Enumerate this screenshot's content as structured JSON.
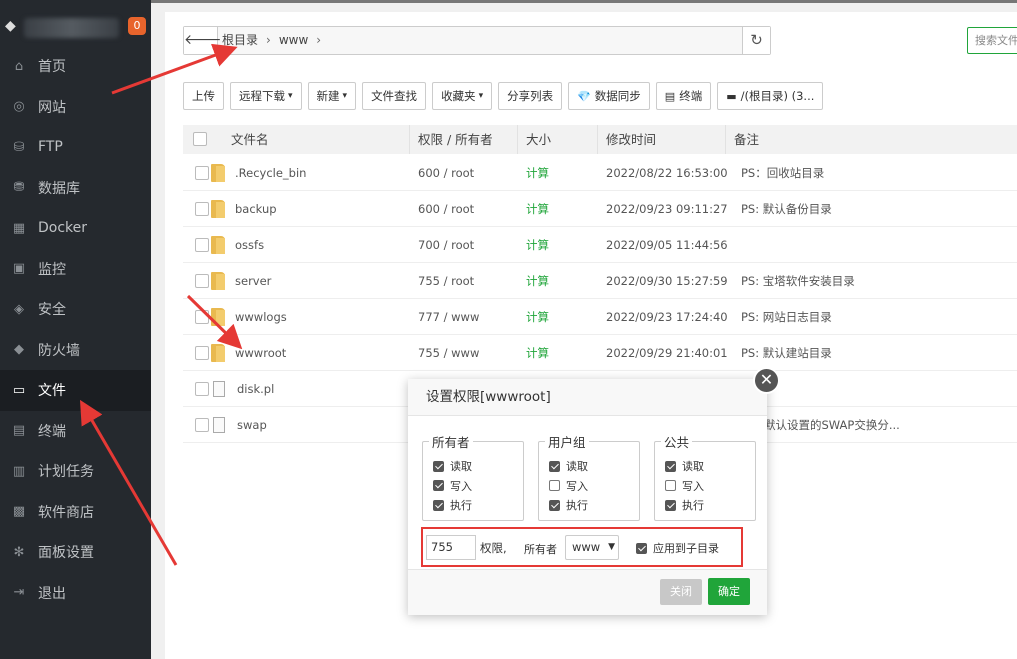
{
  "sidebar": {
    "badge": "0",
    "items": [
      {
        "label": "首页",
        "icon": "home-icon",
        "glyph": "⌂"
      },
      {
        "label": "网站",
        "icon": "globe-icon",
        "glyph": "◎"
      },
      {
        "label": "FTP",
        "icon": "ftp-icon",
        "glyph": "⛁"
      },
      {
        "label": "数据库",
        "icon": "database-icon",
        "glyph": "⛃"
      },
      {
        "label": "Docker",
        "icon": "docker-icon",
        "glyph": "▦"
      },
      {
        "label": "监控",
        "icon": "monitor-icon",
        "glyph": "▣"
      },
      {
        "label": "安全",
        "icon": "shield-check-icon",
        "glyph": "◈"
      },
      {
        "label": "防火墙",
        "icon": "firewall-icon",
        "glyph": "◆"
      },
      {
        "label": "文件",
        "icon": "folder-icon",
        "glyph": "▭"
      },
      {
        "label": "终端",
        "icon": "terminal-icon",
        "glyph": "▤"
      },
      {
        "label": "计划任务",
        "icon": "calendar-icon",
        "glyph": "▥"
      },
      {
        "label": "软件商店",
        "icon": "apps-icon",
        "glyph": "▩"
      },
      {
        "label": "面板设置",
        "icon": "gear-icon",
        "glyph": "✻"
      },
      {
        "label": "退出",
        "icon": "logout-icon",
        "glyph": "⇥"
      }
    ],
    "active_index": 8
  },
  "path": {
    "crumbs": [
      "根目录",
      "www"
    ],
    "sep": "›",
    "back_glyph": "🡐",
    "refresh_glyph": "↻"
  },
  "search": {
    "placeholder": "搜索文件"
  },
  "toolbar": [
    {
      "label": "上传",
      "dropdown": false,
      "icon": ""
    },
    {
      "label": "远程下载",
      "dropdown": true,
      "icon": ""
    },
    {
      "label": "新建",
      "dropdown": true,
      "icon": ""
    },
    {
      "label": "文件查找",
      "dropdown": false,
      "icon": ""
    },
    {
      "label": "收藏夹",
      "dropdown": true,
      "icon": ""
    },
    {
      "label": "分享列表",
      "dropdown": false,
      "icon": ""
    },
    {
      "label": "数据同步",
      "dropdown": false,
      "icon": "💎"
    },
    {
      "label": "终端",
      "dropdown": false,
      "icon": "▤"
    },
    {
      "label": "/(根目录) (3...",
      "dropdown": false,
      "icon": "▬"
    }
  ],
  "table": {
    "headers": {
      "name": "文件名",
      "perm": "权限 / 所有者",
      "size": "大小",
      "time": "修改时间",
      "note": "备注"
    },
    "rows": [
      {
        "type": "folder",
        "name": ".Recycle_bin",
        "perm": "600 / root",
        "size": "计算",
        "time": "2022/08/22 16:53:00",
        "note": "PS：回收站目录"
      },
      {
        "type": "folder",
        "name": "backup",
        "perm": "600 / root",
        "size": "计算",
        "time": "2022/09/23 09:11:27",
        "note": "PS: 默认备份目录"
      },
      {
        "type": "folder",
        "name": "ossfs",
        "perm": "700 / root",
        "size": "计算",
        "time": "2022/09/05 11:44:56",
        "note": ""
      },
      {
        "type": "folder",
        "name": "server",
        "perm": "755 / root",
        "size": "计算",
        "time": "2022/09/30 15:27:59",
        "note": "PS: 宝塔软件安装目录"
      },
      {
        "type": "folder",
        "name": "wwwlogs",
        "perm": "777 / www",
        "size": "计算",
        "time": "2022/09/23 17:24:40",
        "note": "PS: 网站日志目录"
      },
      {
        "type": "folder",
        "name": "wwwroot",
        "perm": "755 / www",
        "size": "计算",
        "time": "2022/09/29 21:40:01",
        "note": "PS: 默认建站目录"
      },
      {
        "type": "file",
        "name": "disk.pl",
        "perm": "",
        "size": "",
        "time": "",
        "note": ""
      },
      {
        "type": "file",
        "name": "swap",
        "perm": "",
        "size": "",
        "time": "",
        "note": "宝塔默认设置的SWAP交换分..."
      }
    ]
  },
  "modal": {
    "title": "设置权限[wwwroot]",
    "close_glyph": "✕",
    "groups": [
      {
        "title": "所有者",
        "options": [
          {
            "label": "读取",
            "checked": true
          },
          {
            "label": "写入",
            "checked": true
          },
          {
            "label": "执行",
            "checked": true
          }
        ]
      },
      {
        "title": "用户组",
        "options": [
          {
            "label": "读取",
            "checked": true
          },
          {
            "label": "写入",
            "checked": false
          },
          {
            "label": "执行",
            "checked": true
          }
        ]
      },
      {
        "title": "公共",
        "options": [
          {
            "label": "读取",
            "checked": true
          },
          {
            "label": "写入",
            "checked": false
          },
          {
            "label": "执行",
            "checked": true
          }
        ]
      }
    ],
    "perm_value": "755",
    "perm_label": "权限,",
    "owner_label": "所有者",
    "owner_value": "www",
    "apply_sub_label": "应用到子目录",
    "apply_sub_checked": true,
    "close_button": "关闭",
    "ok_button": "确定"
  },
  "annotations": {
    "color": "#e53935"
  }
}
